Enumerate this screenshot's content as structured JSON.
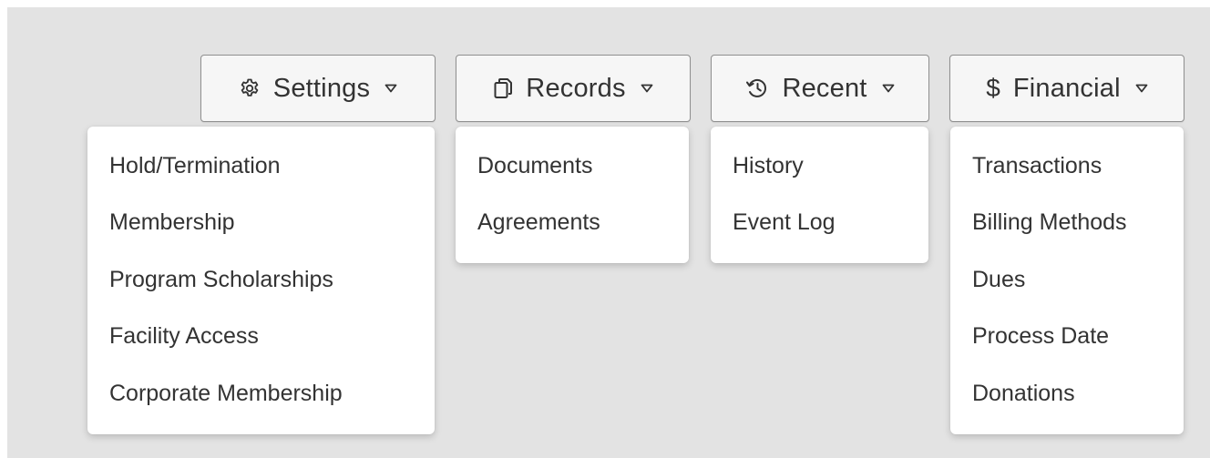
{
  "menus": {
    "settings": {
      "label": "Settings",
      "icon": "gear-icon",
      "items": [
        "Hold/Termination",
        "Membership",
        "Program Scholarships",
        "Facility Access",
        "Corporate Membership"
      ]
    },
    "records": {
      "label": "Records",
      "icon": "copy-document-icon",
      "items": [
        "Documents",
        "Agreements"
      ]
    },
    "recent": {
      "label": "Recent",
      "icon": "history-icon",
      "items": [
        "History",
        "Event Log"
      ]
    },
    "financial": {
      "label": "Financial",
      "icon": "dollar-icon",
      "icon_glyph": "$",
      "items": [
        "Transactions",
        "Billing Methods",
        "Dues",
        "Process Date",
        "Donations"
      ]
    }
  },
  "colors": {
    "background": "#e3e3e3",
    "button_bg": "#f6f6f6",
    "button_border": "#8f8f8f",
    "text": "#333333",
    "dropdown_bg": "#ffffff"
  }
}
